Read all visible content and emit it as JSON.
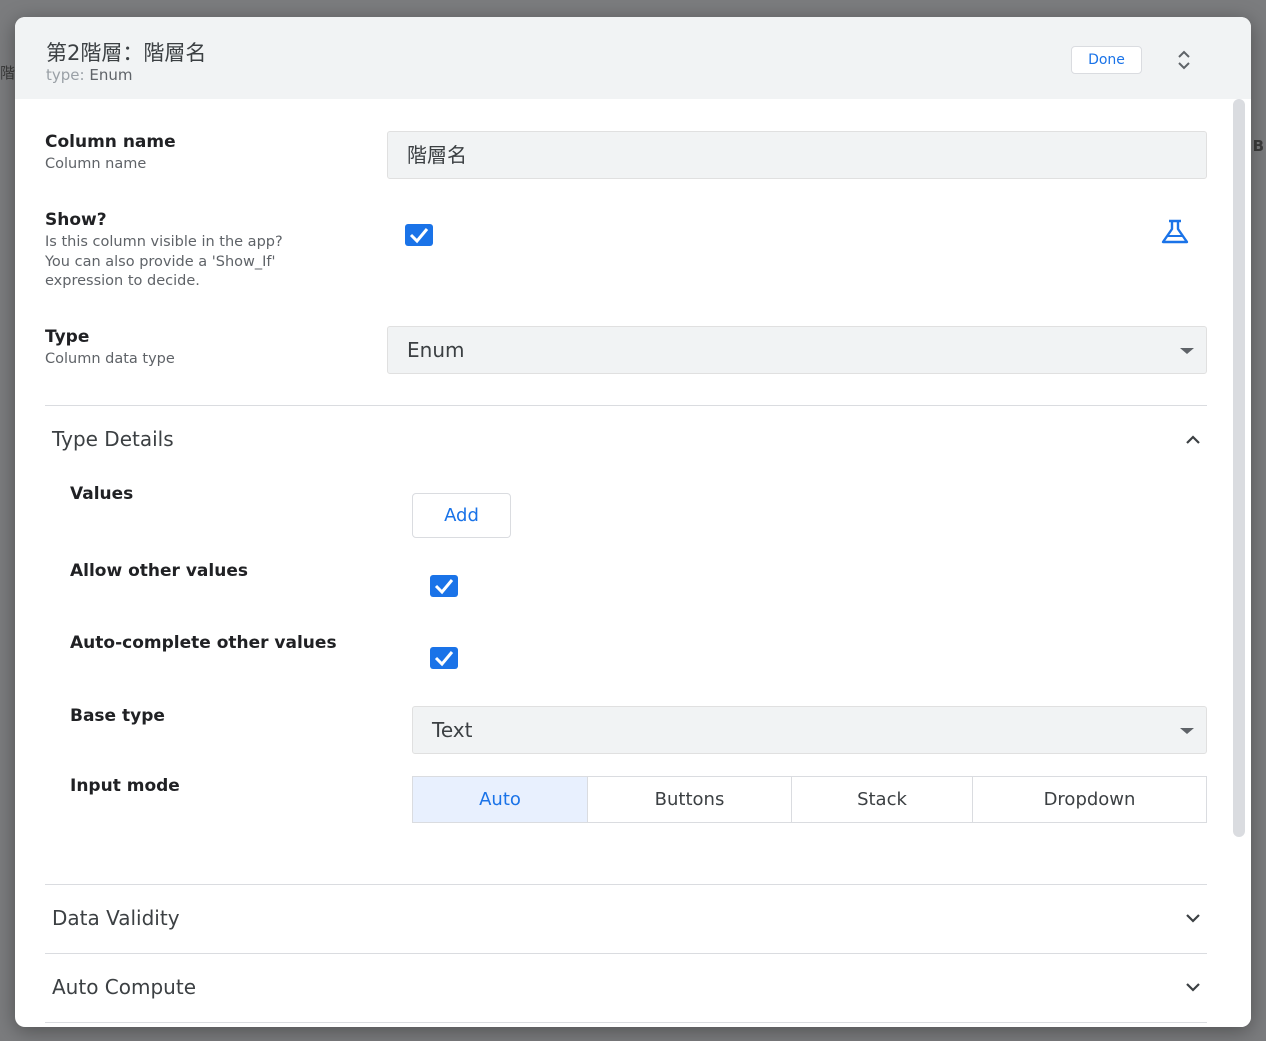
{
  "background": {
    "left_fragment": "階",
    "right_fragment": "B"
  },
  "header": {
    "title": "第2階層：階層名",
    "type_key": "type:",
    "type_value": "Enum",
    "done_label": "Done"
  },
  "fields": {
    "column_name": {
      "label": "Column name",
      "description": "Column name",
      "value": "階層名"
    },
    "show": {
      "label": "Show?",
      "description_lines": [
        "Is this column visible in the app?",
        "You can also provide a 'Show_If'",
        "expression to decide."
      ],
      "checked": true
    },
    "type": {
      "label": "Type",
      "description": "Column data type",
      "value": "Enum"
    }
  },
  "type_details": {
    "title": "Type Details",
    "expanded": true,
    "values_label": "Values",
    "add_label": "Add",
    "allow_other_label": "Allow other values",
    "allow_other_checked": true,
    "autocomplete_label": "Auto-complete other values",
    "autocomplete_checked": true,
    "base_type_label": "Base type",
    "base_type_value": "Text",
    "input_mode_label": "Input mode",
    "input_modes": [
      "Auto",
      "Buttons",
      "Stack",
      "Dropdown"
    ],
    "input_mode_selected": "Auto"
  },
  "sections": {
    "data_validity": "Data Validity",
    "auto_compute": "Auto Compute"
  },
  "colors": {
    "accent": "#1a73e8",
    "selected_segment_bg": "#e8f0fe",
    "field_bg": "#f1f3f4"
  },
  "icons": {
    "expand": "unfold-more-icon",
    "flask": "flask-icon",
    "collapse": "chevron-up-icon",
    "expand_section": "chevron-down-icon"
  }
}
